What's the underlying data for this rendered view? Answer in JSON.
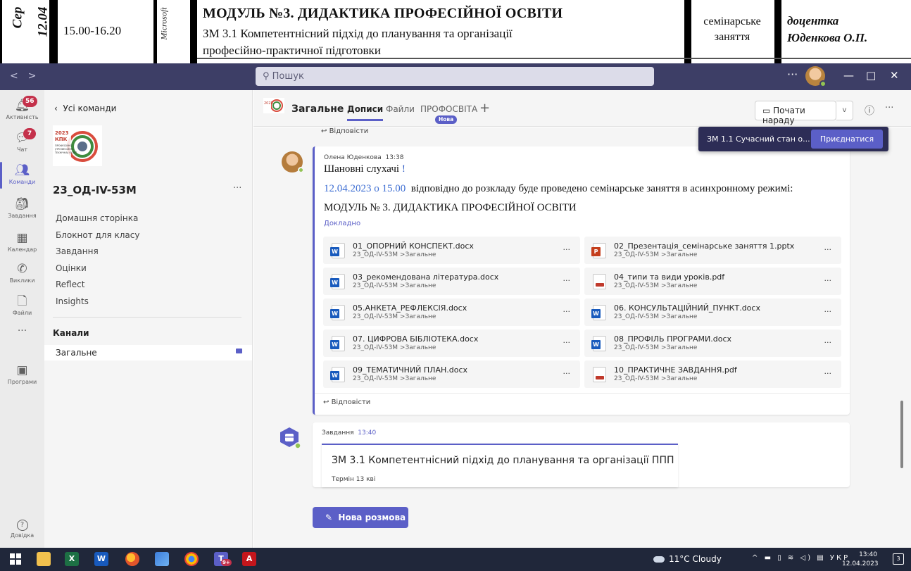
{
  "schedule": {
    "rotated_date_1": "Сер",
    "rotated_date_2": "12.04",
    "time": "15.00-16.20",
    "platform": "Microsoft",
    "module_title": "МОДУЛЬ №3. ДИДАКТИКА ПРОФЕСІЙНОЇ ОСВІТИ",
    "topic_line1": "ЗМ 3.1 Компетентнісний підхід до планування та організації",
    "topic_line2": "професійно-практичної підготовки",
    "class_kind_line1": "семінарське",
    "class_kind_line2": "заняття",
    "teacher_line1": "доцентка",
    "teacher_line2": "Юденкова О.П."
  },
  "titlebar": {
    "back": "<",
    "forward": ">",
    "search_placeholder": "Пошук",
    "more": "···",
    "minimize": "—",
    "maximize": "□",
    "close": "✕"
  },
  "rail": {
    "activity": {
      "label": "Активність",
      "badge": "56"
    },
    "chat": {
      "label": "Чат",
      "badge": "7"
    },
    "teams": {
      "label": "Команди"
    },
    "assignments": {
      "label": "Завдання"
    },
    "calendar": {
      "label": "Календар"
    },
    "calls": {
      "label": "Виклики"
    },
    "files": {
      "label": "Файли"
    },
    "more": "···",
    "apps": {
      "label": "Програми"
    },
    "help": {
      "label": "Довідка"
    }
  },
  "team_panel": {
    "back_label": "Усі команди",
    "team_name": "23_ОД-IV-53М",
    "more": "···",
    "links": [
      "Домашня сторінка",
      "Блокнот для класу",
      "Завдання",
      "Оцінки",
      "Reflect",
      "Insights"
    ],
    "channels_heading": "Канали",
    "channel": "Загальне"
  },
  "channel_header": {
    "title": "Загальне",
    "tabs": [
      "Дописи",
      "Файли",
      "ПРОФОСВІТА"
    ],
    "new_badge": "Нова",
    "add_tab": "+",
    "meet_button": "Почати нараду",
    "meet_dropdown": "v",
    "info": "ⓘ",
    "more": "···"
  },
  "toast": {
    "meeting_title": "ЗМ 1.1 Сучасний стан о...",
    "join_button": "Приєднатися"
  },
  "reply_label": "Відповісти",
  "post": {
    "author": "Олена Юденкова",
    "time": "13:38",
    "greeting": "Шановні слухачі",
    "greeting_mark": "!",
    "date_text": "12.04.2023 о 15.00",
    "body_text": "відповідно до розкладу буде проведено семінарське заняття в асинхронному режимі:",
    "module_line": "МОДУЛЬ № 3. ДИДАКТИКА ПРОФЕСІЙНОЇ ОСВІТИ",
    "more_link": "Докладно",
    "files": [
      {
        "name": "01_ОПОРНИЙ КОНСПЕКТ.docx",
        "path": "23_ОД-IV-53М >Загальне",
        "type": "docx"
      },
      {
        "name": "02_Презентація_семінарське заняття 1.pptx",
        "path": "23_ОД-IV-53М >Загальне",
        "type": "pptx"
      },
      {
        "name": "03_рекомендована література.docx",
        "path": "23_ОД-IV-53М >Загальне",
        "type": "docx"
      },
      {
        "name": "04_типи та види уроків.pdf",
        "path": "23_ОД-IV-53М >Загальне",
        "type": "pdf"
      },
      {
        "name": "05.АНКЕТА_РЕФЛЕКСІЯ.docx",
        "path": "23_ОД-IV-53М >Загальне",
        "type": "docx"
      },
      {
        "name": "06. КОНСУЛЬТАЦІЙНИЙ_ПУНКТ.docx",
        "path": "23_ОД-IV-53М >Загальне",
        "type": "docx"
      },
      {
        "name": "07. ЦИФРОВА БІБЛІОТЕКА.docx",
        "path": "23_ОД-IV-53М >Загальне",
        "type": "docx"
      },
      {
        "name": "08_ПРОФІЛЬ ПРОГРАМИ.docx",
        "path": "23_ОД-IV-53М >Загальне",
        "type": "docx"
      },
      {
        "name": "09_ТЕМАТИЧНИЙ ПЛАН.docx",
        "path": "23_ОД-IV-53М >Загальне",
        "type": "docx"
      },
      {
        "name": "10_ПРАКТИЧНЕ ЗАВДАННЯ.pdf",
        "path": "23_ОД-IV-53М >Загальне",
        "type": "pdf"
      }
    ],
    "file_more": "···"
  },
  "task": {
    "author": "Завдання",
    "time": "13:40",
    "title": "ЗМ 3.1 Компетентнісний підхід до планування та організації ППП",
    "due": "Термін 13 кві"
  },
  "new_conversation": "Нова розмова",
  "taskbar": {
    "weather": "11°C Cloudy",
    "language": "УКР",
    "time": "13:40",
    "date": "12.04.2023",
    "notifications": "3",
    "teams_badge": "9+"
  },
  "colors": {
    "teams_titlebar": "#3d3e66",
    "accent": "#5b5fc7",
    "badge_red": "#c4314b",
    "presence_green": "#92c353"
  }
}
